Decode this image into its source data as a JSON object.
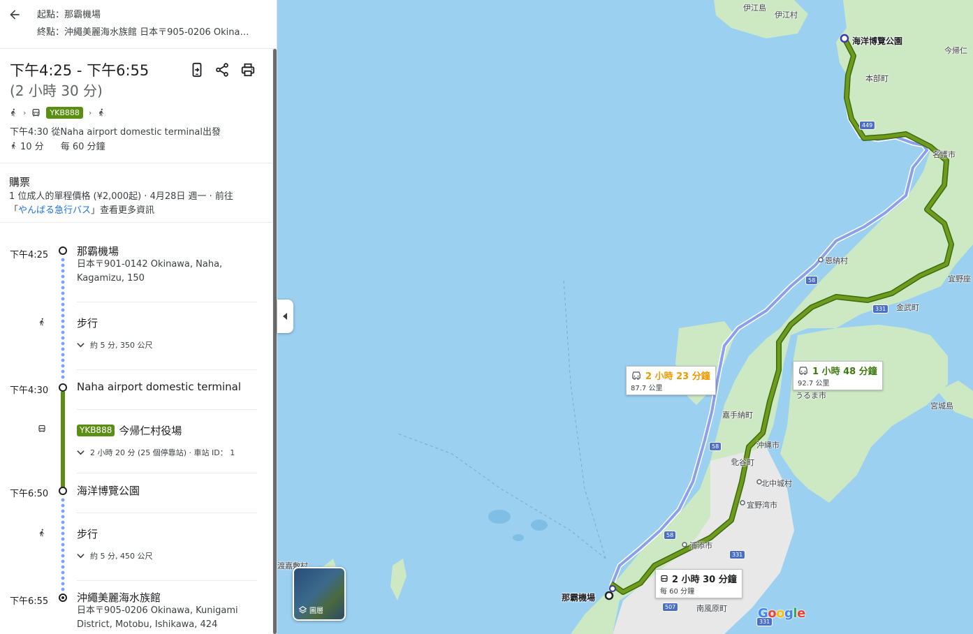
{
  "header": {
    "origin_label": "起點：",
    "origin": "那霸機場",
    "dest_label": "終點：",
    "destination": "沖繩美麗海水族館 日本〒905-0206 Okina…"
  },
  "summary": {
    "time_range": "下午4:25 - 下午6:55",
    "duration": "(2 小時 30 分)",
    "bus_line": "YKB888",
    "departure": "下午4:30 從Naha airport domestic terminal出發",
    "walk_minutes": "10 分",
    "frequency": "每 60 分鐘"
  },
  "tickets": {
    "title": "購票",
    "line1": "1 位成人的單程價格 (¥2,000起) · 4月28日 週一 · 前往",
    "link_prefix": "「",
    "link": "やんばる急行バス",
    "link_suffix": "」查看更多資訊"
  },
  "timeline": {
    "stop1": {
      "time": "下午4:25",
      "name": "那霸機場",
      "address": "日本〒901-0142 Okinawa, Naha, Kagamizu, 150"
    },
    "walk1": {
      "label": "步行",
      "detail": "約 5 分, 350 公尺"
    },
    "stop2": {
      "time": "下午4:30",
      "name": "Naha airport domestic terminal"
    },
    "bus": {
      "line": "YKB888",
      "headsign": "今帰仁村役場",
      "detail": "2 小時 20 分 (25 個停靠站) · 車站 ID： 1"
    },
    "stop3": {
      "time": "下午6:50",
      "name": "海洋博覽公園"
    },
    "walk2": {
      "label": "步行",
      "detail": "約 5 分, 450 公尺"
    },
    "stop4": {
      "time": "下午6:55",
      "name": "沖繩美麗海水族館",
      "address": "日本〒905-0206 Okinawa, Kunigami District, Motobu, Ishikawa, 424"
    }
  },
  "map": {
    "labels": {
      "iejima": "伊江島",
      "iemura": "伊江村",
      "park": "海洋博覽公園",
      "nakijin": "今帰仁",
      "motobu": "本部町",
      "nago": "名護市",
      "onna": "恩納村",
      "ginoza": "宜野座",
      "kin": "金武町",
      "uruma": "うるま市",
      "miyagi": "宮城島",
      "kadena": "嘉手納町",
      "okinawa_city": "沖縄市",
      "chatan": "北谷町",
      "kitanakagusuku": "北中城村",
      "ginowan": "宜野湾市",
      "urasoe": "浦添市",
      "naha_airport": "那霸機場",
      "haebaru": "南風原町",
      "tokashiki": "渡嘉敷村",
      "google": "Google",
      "layers": "圖層"
    },
    "route_boxes": {
      "car_alt": {
        "time": "2 小時 23 分鐘",
        "distance": "87.7 公里"
      },
      "car_main": {
        "time": "1 小時 48 分鐘",
        "distance": "92.7 公里"
      },
      "transit": {
        "time": "2 小時 30 分鐘",
        "frequency": "每 60 分鐘"
      }
    },
    "road_numbers": [
      "449",
      "58",
      "331",
      "58",
      "58",
      "331",
      "507",
      "331"
    ],
    "colors": {
      "transit_route": "#5a8f13",
      "car_route": "#7a94e8",
      "water": "#9bd0f0",
      "land": "#cde9c4"
    }
  }
}
